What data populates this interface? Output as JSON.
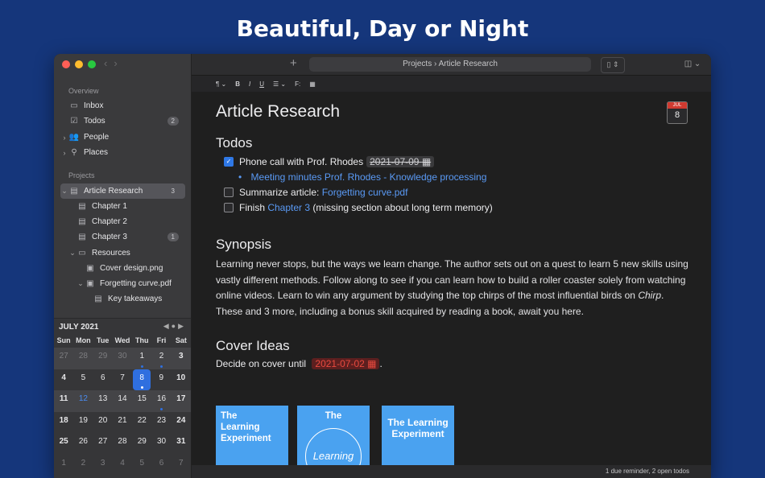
{
  "hero_title": "Beautiful, Day or Night",
  "sidebar": {
    "overview_label": "Overview",
    "overview_items": [
      {
        "label": "Inbox",
        "icon": "tray-icon",
        "badge": ""
      },
      {
        "label": "Todos",
        "icon": "checkbox-icon",
        "badge": "2"
      },
      {
        "label": "People",
        "icon": "people-icon",
        "badge": ""
      },
      {
        "label": "Places",
        "icon": "location-icon",
        "badge": ""
      }
    ],
    "projects_label": "Projects",
    "project_items": [
      {
        "label": "Article Research",
        "badge": "3"
      },
      {
        "label": "Chapter 1",
        "badge": ""
      },
      {
        "label": "Chapter 2",
        "badge": ""
      },
      {
        "label": "Chapter 3",
        "badge": "1"
      },
      {
        "label": "Resources",
        "badge": ""
      },
      {
        "label": "Cover design.png",
        "badge": ""
      },
      {
        "label": "Forgetting curve.pdf",
        "badge": ""
      },
      {
        "label": "Key takeaways",
        "badge": ""
      }
    ]
  },
  "calendar": {
    "month_label": "JULY 2021",
    "weekdays": [
      "Sun",
      "Mon",
      "Tue",
      "Wed",
      "Thu",
      "Fri",
      "Sat"
    ],
    "weeks": [
      [
        "27",
        "28",
        "29",
        "30",
        "1",
        "2",
        "3"
      ],
      [
        "4",
        "5",
        "6",
        "7",
        "8",
        "9",
        "10"
      ],
      [
        "11",
        "12",
        "13",
        "14",
        "15",
        "16",
        "17"
      ],
      [
        "18",
        "19",
        "20",
        "21",
        "22",
        "23",
        "24"
      ],
      [
        "25",
        "26",
        "27",
        "28",
        "29",
        "30",
        "31"
      ],
      [
        "1",
        "2",
        "3",
        "4",
        "5",
        "6",
        "7"
      ]
    ],
    "today": "8"
  },
  "toolbar": {
    "add": "+",
    "path_root": "Projects",
    "path_separator": "›",
    "path_current": "Article Research"
  },
  "format_bar": {
    "paragraph": "¶ ⌄",
    "bold": "B",
    "italic": "I",
    "underline": "U",
    "list": "☰ ⌄",
    "footnote": "F:"
  },
  "document": {
    "title": "Article Research",
    "calendar_icon_month": "JUL",
    "calendar_icon_day": "8",
    "todos_heading": "Todos",
    "todo1_text": "Phone call with Prof. Rhodes",
    "todo1_date": "2021-07-09",
    "todo1_sub_link": "Meeting minutes Prof. Rhodes - Knowledge processing",
    "todo2_prefix": "Summarize article: ",
    "todo2_link": "Forgetting curve.pdf",
    "todo3_prefix": "Finish ",
    "todo3_link": "Chapter 3",
    "todo3_suffix": " (missing section about long term memory)",
    "synopsis_heading": "Synopsis",
    "synopsis_part1": "Learning never stops, but the ways we learn change. The author sets out on a quest to learn 5 new skills using vastly different methods. Follow along to see if you can learn how to build a roller coaster solely from watching online videos. Learn to win any argument by studying the top chirps of the most influential birds on ",
    "synopsis_italic": "Chirp",
    "synopsis_part2": ". These and 3 more, including a bonus skill acquired by reading a book, await you here.",
    "cover_heading": "Cover Ideas",
    "cover_prefix": "Decide on cover until ",
    "cover_date": "2021-07-02",
    "cover_suffix": ".",
    "covers": [
      "The Learning Experiment",
      "The",
      "The Learning Experiment"
    ],
    "cover2_script": "Learning"
  },
  "status_text": "1 due reminder, 2 open todos",
  "colors": {
    "accent": "#2f78e6",
    "link": "#5a9af5",
    "alert": "#e94a3f",
    "background": "#15367b"
  }
}
